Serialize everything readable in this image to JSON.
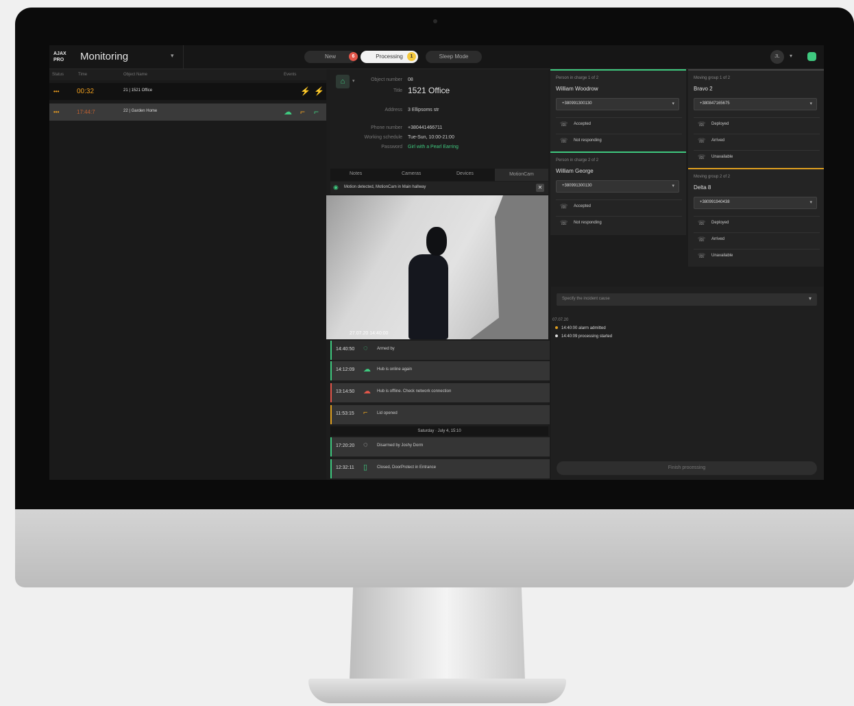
{
  "app": {
    "title": "Monitoring",
    "logo": "AJAX PRO"
  },
  "topbar": {
    "tabs": [
      {
        "label": "New",
        "badge": "6"
      },
      {
        "label": "Processing",
        "badge": "1"
      },
      {
        "label": "Sleep Mode",
        "badge": ""
      }
    ],
    "user_initials": "JL"
  },
  "alarm_list": {
    "headers": [
      "Status",
      "Time",
      "Object Name",
      "Events"
    ],
    "rows": [
      {
        "status": "•••",
        "time": "00:32",
        "object": "21 | 1521 Office"
      },
      {
        "status": "•••",
        "time": "17:44:7",
        "object": "22 | Garden Home"
      }
    ]
  },
  "object": {
    "number_label": "Object number",
    "number": "08",
    "title_label": "Title",
    "title": "1521 Office",
    "address_label": "Address",
    "address": "3 Ellipsoms str",
    "phone_label": "Phone number",
    "phone": "+380441466711",
    "schedule_label": "Working schedule",
    "schedule": "Tue-Sun, 10:00-21:00",
    "password_label": "Password",
    "password": "Girl with a Pearl Earring"
  },
  "detail_tabs": [
    "Notes",
    "Cameras",
    "Devices",
    "MotionCam"
  ],
  "camera": {
    "header": "Motion detected, MotionCam in Main hallway",
    "timestamp": "27.07.20 14:40:00"
  },
  "events": [
    {
      "time": "14:40:50",
      "icon": "arming-icon",
      "text": "Armed by"
    },
    {
      "time": "14:12:09",
      "icon": "hub-icon",
      "text": "Hub is online again"
    },
    {
      "time": "13:14:50",
      "icon": "hub-offline-icon",
      "text": "Hub is offline. Check network connection"
    },
    {
      "time": "11:53:15",
      "icon": "motioncam-icon",
      "text": "Lid opened"
    },
    {
      "time": "17:20:20",
      "icon": "disarm-icon",
      "text": "Disarmed by Joshy Dorm"
    },
    {
      "time": "12:32:11",
      "icon": "door-icon",
      "text": "Closed, DoorProtect in Entrance"
    }
  ],
  "day_header": "Saturday · July 4, 15:10",
  "persons": [
    {
      "sub": "Person in charge 1 of 2",
      "name": "William Woodrow",
      "phone": "+380991300130",
      "options": [
        "Accepted",
        "Not responding"
      ]
    },
    {
      "sub": "Person in charge 2 of 2",
      "name": "William George",
      "phone": "+380991300130",
      "options": [
        "Accepted",
        "Not responding"
      ]
    }
  ],
  "groups": [
    {
      "sub": "Moving group 1 of 2",
      "name": "Bravo 2",
      "phone": "+380847165675",
      "options": [
        "Deployed",
        "Arrived",
        "Unavailable"
      ]
    },
    {
      "sub": "Moving group 2 of 2",
      "name": "Delta 8",
      "phone": "+380991940438",
      "options": [
        "Deployed",
        "Arrived",
        "Unavailable"
      ]
    }
  ],
  "log": {
    "input_placeholder": "Specify the incident cause",
    "date": "07.07.20",
    "entries": [
      {
        "text": "14:40:00 alarm admitted",
        "color": "#e0a020"
      },
      {
        "text": "14:40:09 processing started",
        "color": "#dddddd"
      }
    ]
  },
  "finish_label": "Finish processing",
  "colors": {
    "accent": "#3fc97f",
    "alarm": "#f0a020",
    "danger": "#e2564a"
  }
}
